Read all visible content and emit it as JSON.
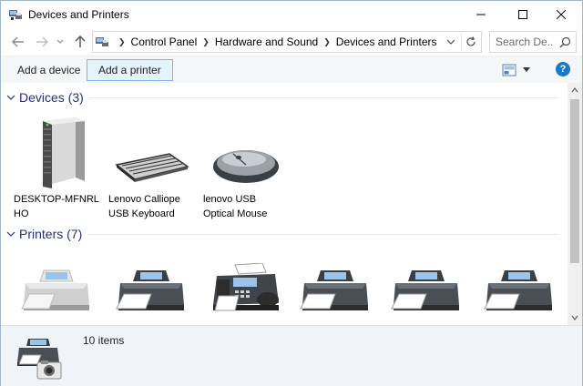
{
  "window": {
    "title": "Devices and Printers"
  },
  "address": {
    "crumbs": [
      "Control Panel",
      "Hardware and Sound",
      "Devices and Printers"
    ]
  },
  "search": {
    "placeholder": "Search De..."
  },
  "commands": {
    "add_device": "Add a device",
    "add_printer": "Add a printer",
    "help": "?"
  },
  "groups": {
    "devices": {
      "title": "Devices (3)",
      "items": [
        {
          "label": "DESKTOP-MFNRLHO",
          "icon": "computer-tower-icon"
        },
        {
          "label": "Lenovo Calliope USB Keyboard",
          "icon": "keyboard-icon"
        },
        {
          "label": "lenovo USB Optical Mouse",
          "icon": "mouse-icon"
        }
      ]
    },
    "printers": {
      "title": "Printers (7)",
      "items": [
        {
          "icon": "printer-default-icon"
        },
        {
          "icon": "printer-icon"
        },
        {
          "icon": "fax-icon"
        },
        {
          "icon": "printer-icon"
        },
        {
          "icon": "printer-icon"
        },
        {
          "icon": "printer-icon"
        }
      ]
    }
  },
  "details": {
    "count": "10 items"
  },
  "colors": {
    "group_title": "#1e3287",
    "accent": "#1979ca",
    "selected_button_border": "#7eb4ea"
  }
}
